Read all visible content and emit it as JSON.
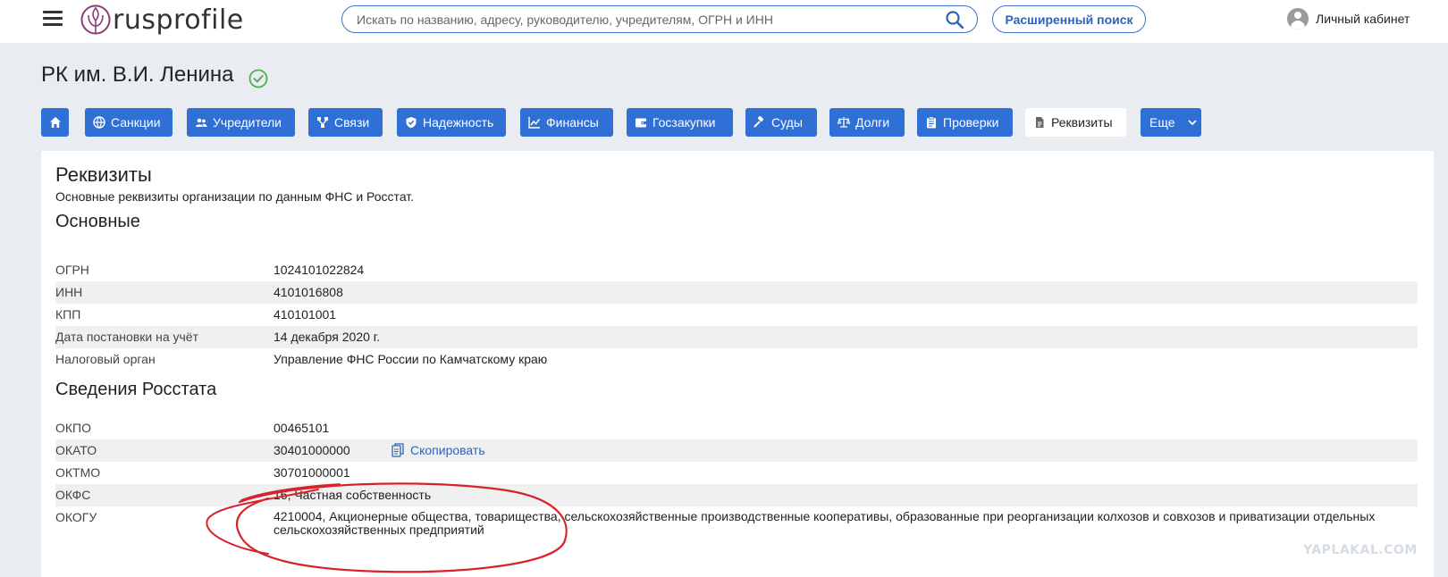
{
  "header": {
    "logo_text": "rusprofile",
    "search_placeholder": "Искать по названию, адресу, руководителю, учредителям, ОГРН и ИНН",
    "advanced_search_label": "Расширенный поиск",
    "account_label": "Личный кабинет"
  },
  "company": {
    "title": "РК им. В.И. Ленина",
    "status_color": "#4caf50"
  },
  "tabs": [
    {
      "label": "",
      "icon": "home-icon"
    },
    {
      "label": "Санкции",
      "icon": "globe-icon"
    },
    {
      "label": "Учредители",
      "icon": "people-icon"
    },
    {
      "label": "Связи",
      "icon": "network-icon"
    },
    {
      "label": "Надежность",
      "icon": "shield-check-icon"
    },
    {
      "label": "Финансы",
      "icon": "chart-icon"
    },
    {
      "label": "Госзакупки",
      "icon": "wallet-icon"
    },
    {
      "label": "Суды",
      "icon": "gavel-icon"
    },
    {
      "label": "Долги",
      "icon": "scales-icon"
    },
    {
      "label": "Проверки",
      "icon": "clipboard-icon"
    },
    {
      "label": "Реквизиты",
      "icon": "document-icon",
      "active": true
    },
    {
      "label": "Еще",
      "icon": "chevron-down-icon"
    }
  ],
  "requisites": {
    "title": "Реквизиты",
    "subtitle": "Основные реквизиты организации по данным ФНС и Росстат.",
    "main_section": {
      "title": "Основные",
      "rows": [
        {
          "label": "ОГРН",
          "value": "1024101022824"
        },
        {
          "label": "ИНН",
          "value": "4101016808"
        },
        {
          "label": "КПП",
          "value": "410101001"
        },
        {
          "label": "Дата постановки на учёт",
          "value": "14 декабря 2020 г."
        },
        {
          "label": "Налоговый орган",
          "value": "Управление ФНС России по Камчатскому краю"
        }
      ]
    },
    "rosstat_section": {
      "title": "Сведения Росстата",
      "rows": [
        {
          "label": "ОКПО",
          "value": "00465101"
        },
        {
          "label": "ОКАТО",
          "value": "30401000000",
          "action": "Скопировать"
        },
        {
          "label": "ОКТМО",
          "value": "30701000001"
        },
        {
          "label": "ОКФС",
          "value": "16, Частная собственность"
        },
        {
          "label": "ОКОГУ",
          "value": "4210004, Акционерные общества, товарищества, сельскохозяйственные производственные кооперативы, образованные при реорганизации колхозов и совхозов и приватизации отдельных сельскохозяйственных предприятий"
        }
      ]
    }
  },
  "watermark": "YAPLAKAL.COM",
  "colors": {
    "accent": "#2f6fd6",
    "link": "#2e63b8",
    "annotation": "#d8222a"
  }
}
